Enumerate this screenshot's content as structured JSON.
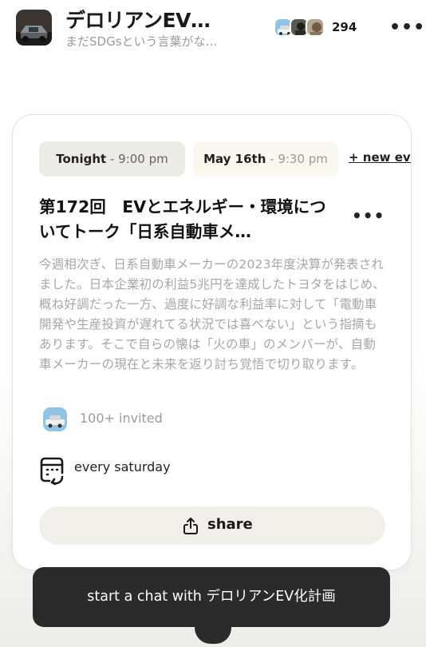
{
  "header": {
    "club_name": "デロリアンEV…",
    "club_description": "まだSDGsという言葉がな…",
    "member_count": "294",
    "more_icon": "ellipsis-icon"
  },
  "event": {
    "date_options": [
      {
        "day": "Tonight",
        "time": "9:00 pm"
      },
      {
        "day": "May 16th",
        "time": "9:30 pm"
      }
    ],
    "new_event_label": "+ new eve",
    "separator": " - ",
    "title": "第172回　EVとエネルギー・環境についてトーク「日系自動車メ…",
    "description": "今週相次ぎ、日系自動車メーカーの2023年度決算が発表されました。日本企業初の利益5兆円を達成したトヨタをはじめ、概ね好調だった一方、過度に好調な利益率に対して「電動車開発や生産投資が遅れてる状況では喜べない」という指摘もあります。そこで自らの懐は「火の車」のメンバーが、自動車メーカーの現在と未来を返り討ち覚悟で切り取ります。",
    "invited_text": "100+ invited",
    "recurrence_text": "every saturday",
    "share_label": "share"
  },
  "chat": {
    "button_label": "start a chat with デロリアンEV化計画"
  },
  "colors": {
    "dark_button": "#2b2b2b",
    "pill_selected": "#ecebe6",
    "pill_unselected": "#f9f7ee",
    "share_bg": "#f1efe9",
    "muted_text": "#a6a6a6"
  }
}
